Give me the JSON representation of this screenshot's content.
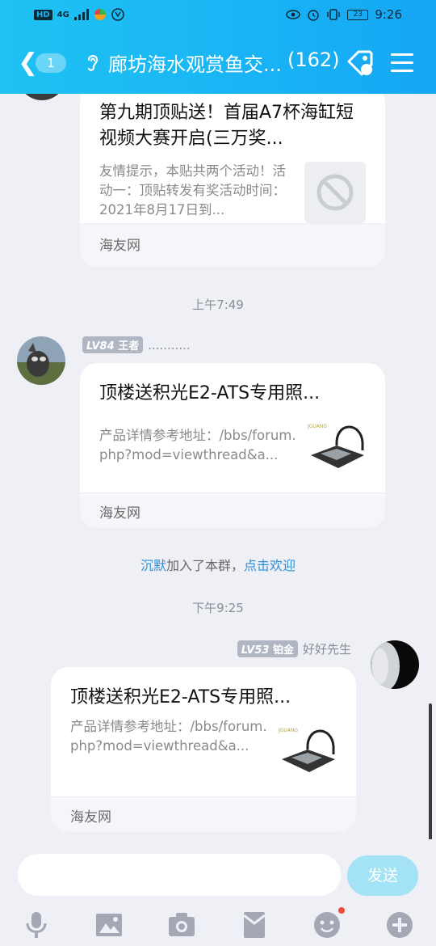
{
  "status_bar": {
    "left_chip": "HD",
    "network": "4G",
    "battery": "23",
    "time": "9:26"
  },
  "header": {
    "back_badge": "1",
    "title": "廊坊海水观赏鱼交...",
    "member_count": "(162)"
  },
  "messages": [
    {
      "card_title": "第九期顶贴送！首届A7杯海缸短视频大赛开启(三万奖...",
      "card_desc": "友情提示，本贴共两个活动！活动一：顶贴转发有奖活动时间：2021年8月17日到...",
      "source": "海友网"
    },
    {
      "time": "上午7:49",
      "level": "LV84",
      "rank": "王者",
      "name": "...........",
      "card_title": "顶楼送积光E2-ATS专用照...",
      "card_desc": "产品详情参考地址：/bbs/forum.php?mod=viewthread&a...",
      "source": "海友网"
    },
    {
      "system_user": "沉默",
      "system_text": "加入了本群，",
      "system_link": "点击欢迎"
    },
    {
      "time": "下午9:25",
      "level": "LV53",
      "rank": "铂金",
      "name": "好好先生",
      "card_title": "顶楼送积光E2-ATS专用照...",
      "card_desc": "产品详情参考地址：/bbs/forum.php?mod=viewthread&a...",
      "source": "海友网"
    }
  ],
  "input": {
    "placeholder": "",
    "send_label": "发送"
  },
  "toolbar": {
    "icons": [
      "mic-icon",
      "image-icon",
      "camera-icon",
      "red-packet-icon",
      "emoji-icon",
      "plus-icon"
    ]
  },
  "colors": {
    "header_start": "#1fc2f2",
    "header_end": "#16a6f4",
    "send_button": "#a3e3f5",
    "link": "#2f8fd6"
  }
}
